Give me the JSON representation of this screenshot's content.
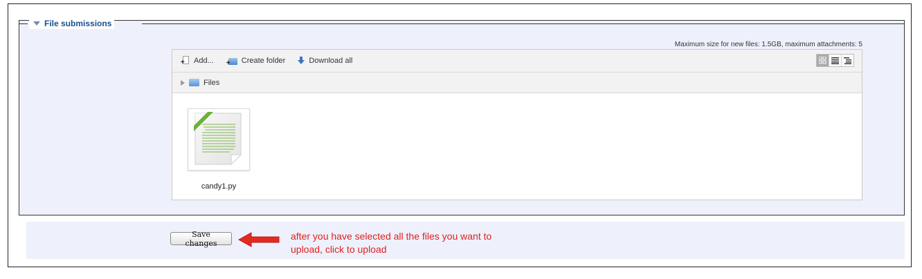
{
  "fieldset": {
    "legend": "File submissions"
  },
  "filepicker": {
    "max_note": "Maximum size for new files: 1.5GB, maximum attachments: 5",
    "toolbar": {
      "add_label": "Add...",
      "create_folder_label": "Create folder",
      "download_all_label": "Download all"
    },
    "path": {
      "folder_label": "Files"
    },
    "files": [
      {
        "name": "candy1.py"
      }
    ]
  },
  "form": {
    "save_label": "Save changes"
  },
  "annotation": {
    "text": "after you have selected all the files you want to upload, click to upload",
    "color": "#e02020"
  },
  "colors": {
    "accent": "#1a4f8f",
    "panel_bg": "#eef1fb"
  }
}
